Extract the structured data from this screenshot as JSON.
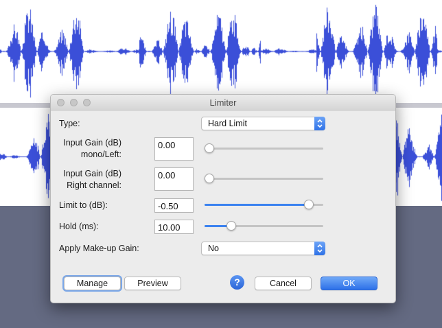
{
  "window": {
    "title": "Limiter"
  },
  "params": {
    "type_label": "Type:",
    "type_value": "Hard Limit",
    "input_gain_left_label_1": "Input Gain (dB)",
    "input_gain_left_label_2": "mono/Left:",
    "input_gain_left_value": "0.00",
    "input_gain_right_label_1": "Input Gain (dB)",
    "input_gain_right_label_2": "Right channel:",
    "input_gain_right_value": "0.00",
    "limit_label": "Limit to (dB):",
    "limit_value": "-0.50",
    "hold_label": "Hold (ms):",
    "hold_value": "10.00",
    "makeup_label": "Apply Make-up Gain:",
    "makeup_value": "No"
  },
  "sliders": {
    "input_gain_left": 0.0,
    "input_gain_right": 0.0,
    "limit_to": 0.91,
    "hold": 0.2
  },
  "buttons": {
    "manage": "Manage",
    "preview": "Preview",
    "help": "?",
    "cancel": "Cancel",
    "ok": "OK"
  },
  "colors": {
    "waveform": "#3b4fd8",
    "accent": "#3b82f0"
  },
  "icons": {
    "help": "help-icon",
    "dropdown": "chevron-updown-icon"
  }
}
